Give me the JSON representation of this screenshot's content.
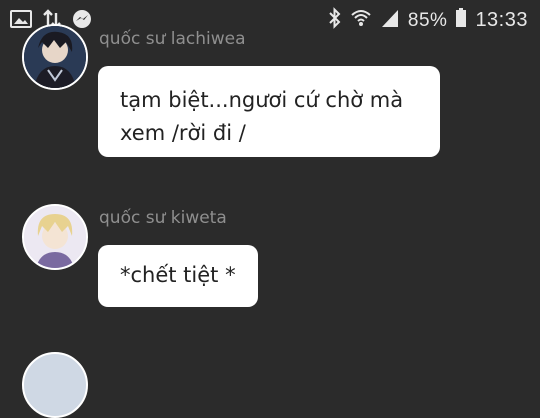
{
  "status_bar": {
    "battery_pct": "85%",
    "time": "13:33",
    "icons": [
      "image-icon",
      "data-transfer-icon",
      "messenger-icon",
      "bluetooth-icon",
      "wifi-icon",
      "signal-icon",
      "battery-icon"
    ]
  },
  "messages": [
    {
      "username": "quốc sư lachiwea",
      "text": "tạm biệt...ngươi cứ chờ mà xem /rời đi /"
    },
    {
      "username": "quốc sư kiweta",
      "text": "*chết tiệt *"
    }
  ],
  "colors": {
    "background": "#2b2b2b",
    "bubble": "#ffffff",
    "username": "#8f8f8f"
  }
}
